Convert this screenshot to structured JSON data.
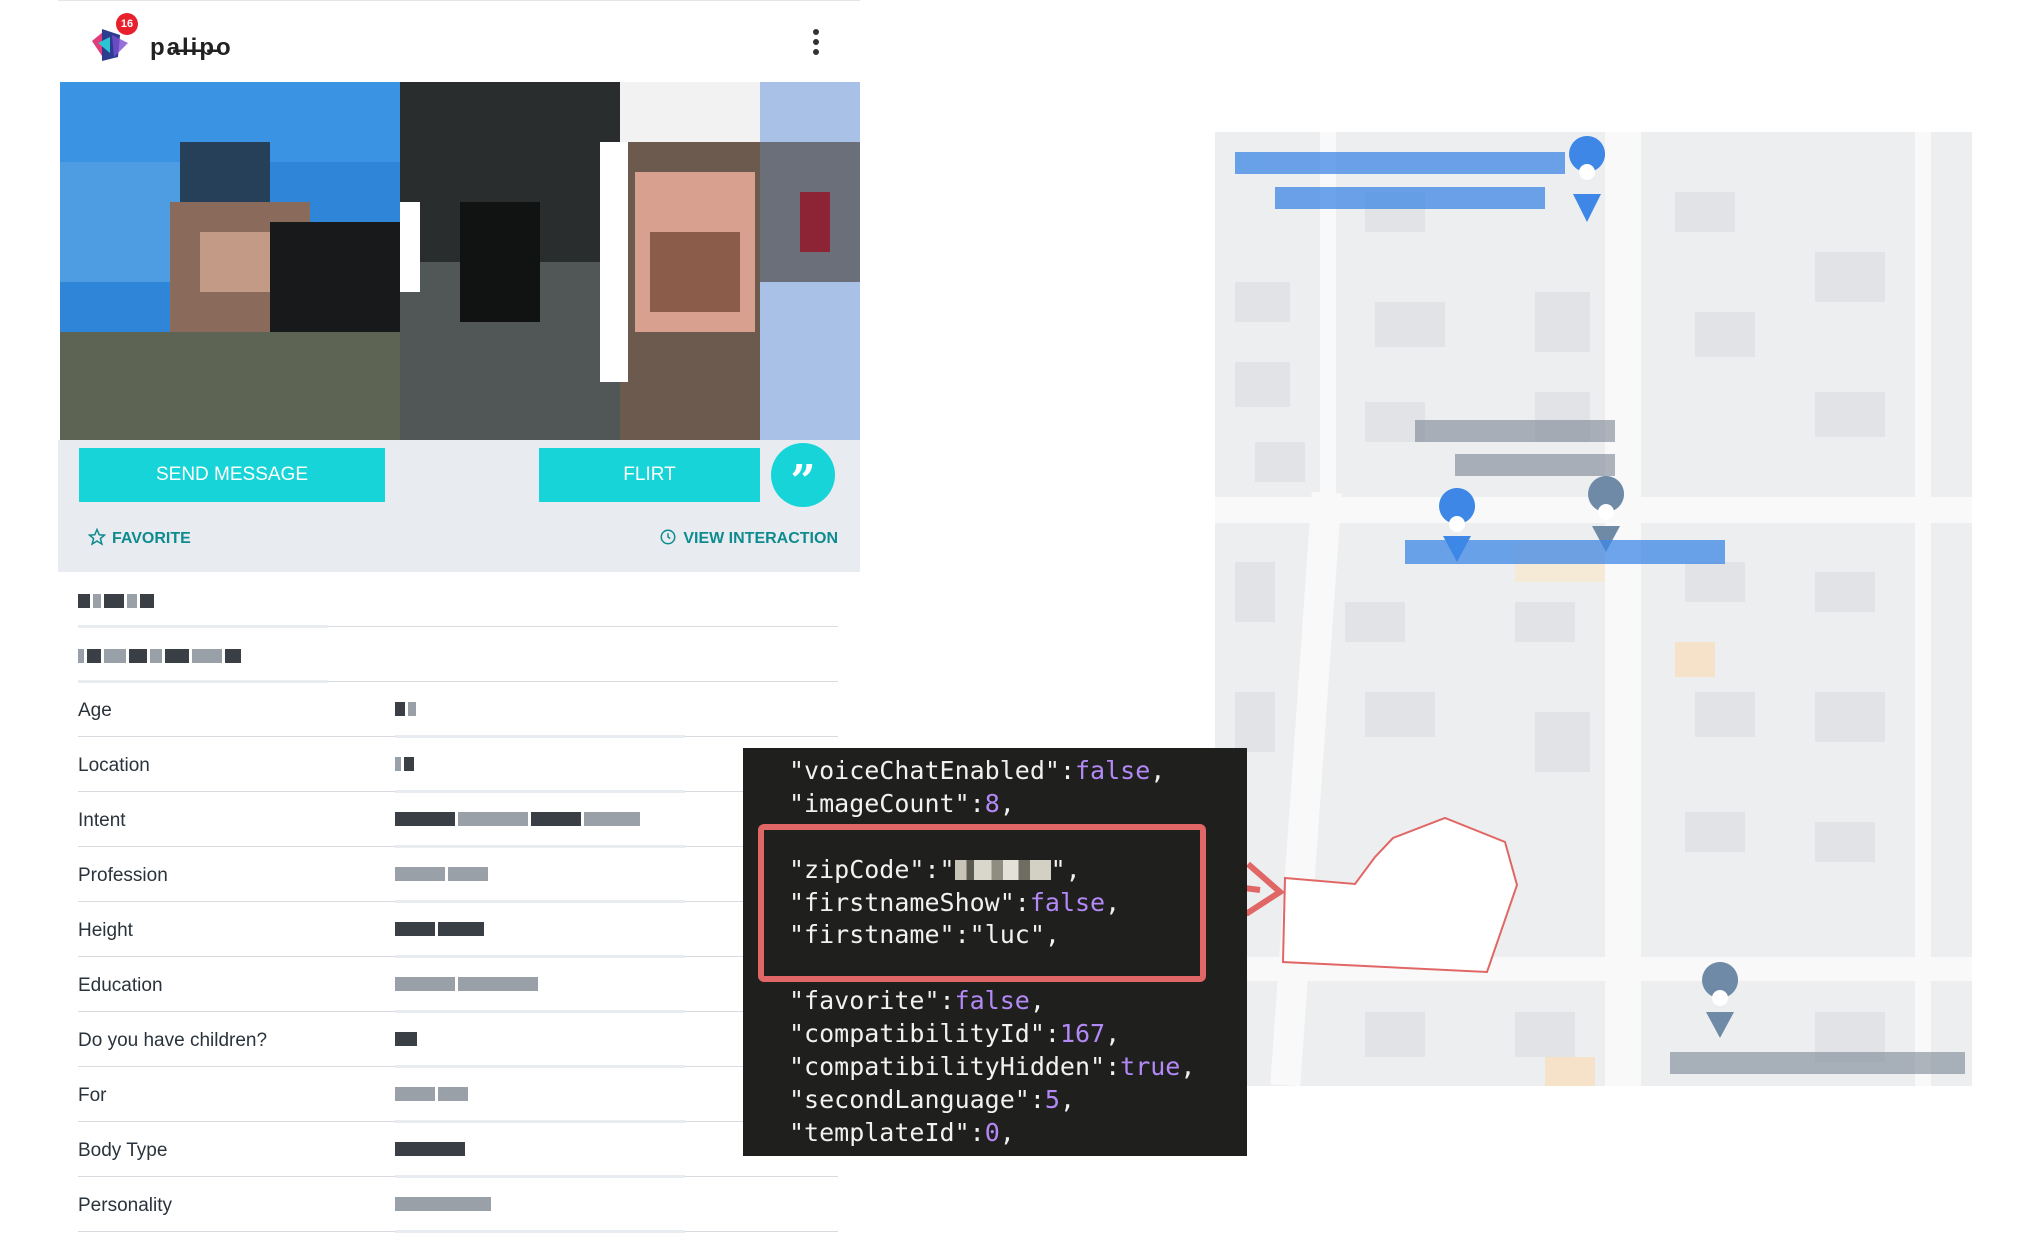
{
  "app": {
    "brand_name": "pa̶l̶i̶p̶o",
    "notification_count": "16",
    "menu_icon": "more-vertical-icon"
  },
  "actions": {
    "send_message_label": "SEND MESSAGE",
    "flirt_label": "FLIRT",
    "quote_icon": "quote-icon",
    "favorite_label": "FAVORITE",
    "view_interaction_label": "VIEW INTERACTION"
  },
  "profile_details": [
    {
      "label": "Age"
    },
    {
      "label": "Location"
    },
    {
      "label": "Intent"
    },
    {
      "label": "Profession"
    },
    {
      "label": "Height"
    },
    {
      "label": "Education"
    },
    {
      "label": "Do you have children?"
    },
    {
      "label": "For"
    },
    {
      "label": "Body Type"
    },
    {
      "label": "Personality"
    }
  ],
  "code": {
    "lines": [
      {
        "key": "\"voiceChatEnabled\"",
        "value": "false",
        "trail": ","
      },
      {
        "key": "\"imageCount\"",
        "value": "8",
        "trail": ","
      },
      {
        "key": "\"zipCode\"",
        "value": "\"",
        "trail": "\","
      },
      {
        "key": "\"firstnameShow\"",
        "value": "false",
        "trail": ","
      },
      {
        "key": "\"firstname\"",
        "value": "\"luc\"",
        "trail": ","
      },
      {
        "key": "\"favorite\"",
        "value": "false",
        "trail": ","
      },
      {
        "key": "\"compatibilityId\"",
        "value": "167",
        "trail": ","
      },
      {
        "key": "\"compatibilityHidden\"",
        "value": "true",
        "trail": ","
      },
      {
        "key": "\"secondLanguage\"",
        "value": "5",
        "trail": ","
      },
      {
        "key": "\"templateId\"",
        "value": "0",
        "trail": ","
      }
    ]
  },
  "colors": {
    "accent": "#16d4d8",
    "link": "#0e8b8f",
    "highlight": "#e06765",
    "code_bg": "#1f1f1d",
    "code_keyword": "#b389f7",
    "map_poi": "#3e87e6"
  }
}
